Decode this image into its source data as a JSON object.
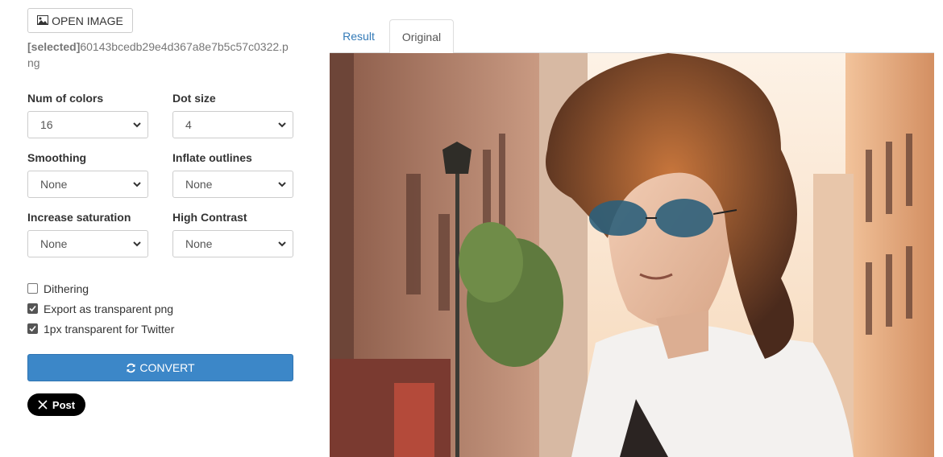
{
  "toolbar": {
    "open_label": "OPEN IMAGE"
  },
  "file": {
    "prefix": "[selected]",
    "name": "60143bcedb29e4d367a8e7b5c57c0322.png"
  },
  "options": {
    "num_colors": {
      "label": "Num of colors",
      "value": "16"
    },
    "dot_size": {
      "label": "Dot size",
      "value": "4"
    },
    "smoothing": {
      "label": "Smoothing",
      "value": "None"
    },
    "inflate_outlines": {
      "label": "Inflate outlines",
      "value": "None"
    },
    "increase_saturation": {
      "label": "Increase saturation",
      "value": "None"
    },
    "high_contrast": {
      "label": "High Contrast",
      "value": "None"
    }
  },
  "checkboxes": [
    {
      "label": "Dithering",
      "checked": false
    },
    {
      "label": "Export as transparent png",
      "checked": true
    },
    {
      "label": "1px transparent for Twitter",
      "checked": true
    }
  ],
  "actions": {
    "convert_label": "CONVERT",
    "post_label": "Post"
  },
  "tabs": [
    {
      "label": "Result",
      "active": false
    },
    {
      "label": "Original",
      "active": true
    }
  ],
  "colors": {
    "primary": "#3c87c8",
    "link": "#337ab7"
  }
}
